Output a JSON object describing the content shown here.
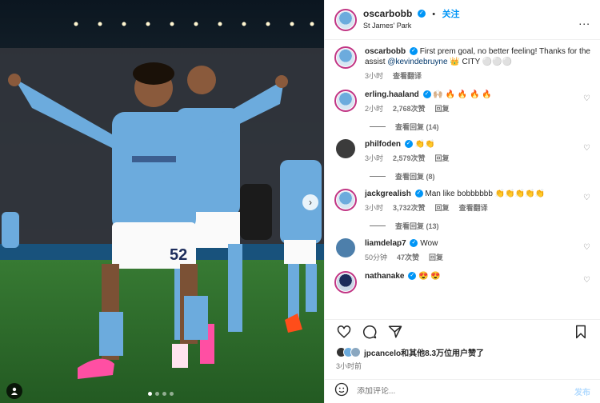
{
  "post": {
    "author": "oscarbobb",
    "follow_label": "关注",
    "separator": "•",
    "location": "St James' Park",
    "caption_pre": "First prem goal, no better feeling! Thanks for the assist ",
    "caption_mention": "@kevindebruyne",
    "caption_post": " 👑 CITY ⚪⚪⚪",
    "caption_time": "3小时",
    "caption_translate": "查看翻译",
    "more_label": "...",
    "next_label": "›"
  },
  "comments": [
    {
      "user": "erling.haaland",
      "text": "🙌🏼 🔥 🔥 🔥 🔥",
      "time": "2小时",
      "likes": "2,768次赞",
      "reply": "回复",
      "view_replies": "查看回复 (14)",
      "avatar_color": "#6cabdd"
    },
    {
      "user": "philfoden",
      "text": "👏👏",
      "time": "3小时",
      "likes": "2,579次赞",
      "reply": "回复",
      "view_replies": "查看回复 (8)",
      "avatar_color": "#333333"
    },
    {
      "user": "jackgrealish",
      "text": "Man like bobbbbbb 👏👏👏👏👏",
      "time": "3小时",
      "likes": "3,732次赞",
      "reply": "回复",
      "translate": "查看翻译",
      "view_replies": "查看回复 (13)",
      "avatar_color": "#6cabdd"
    },
    {
      "user": "liamdelap7",
      "text": "Wow",
      "time": "50分钟",
      "likes": "47次赞",
      "reply": "回复",
      "avatar_color": "#2a4f74"
    },
    {
      "user": "nathanake",
      "text": "😍 😍",
      "time": "",
      "likes": "",
      "reply": "",
      "avatar_color": "#1c2c5b"
    }
  ],
  "likes": {
    "text": "jpcancelo和其他8.3万位用户赞了",
    "time": "3小时前"
  },
  "add_comment": {
    "placeholder": "添加评论...",
    "post_label": "发布"
  },
  "colors": {
    "city_blue": "#6cabdd",
    "link_blue": "#0095f6"
  }
}
